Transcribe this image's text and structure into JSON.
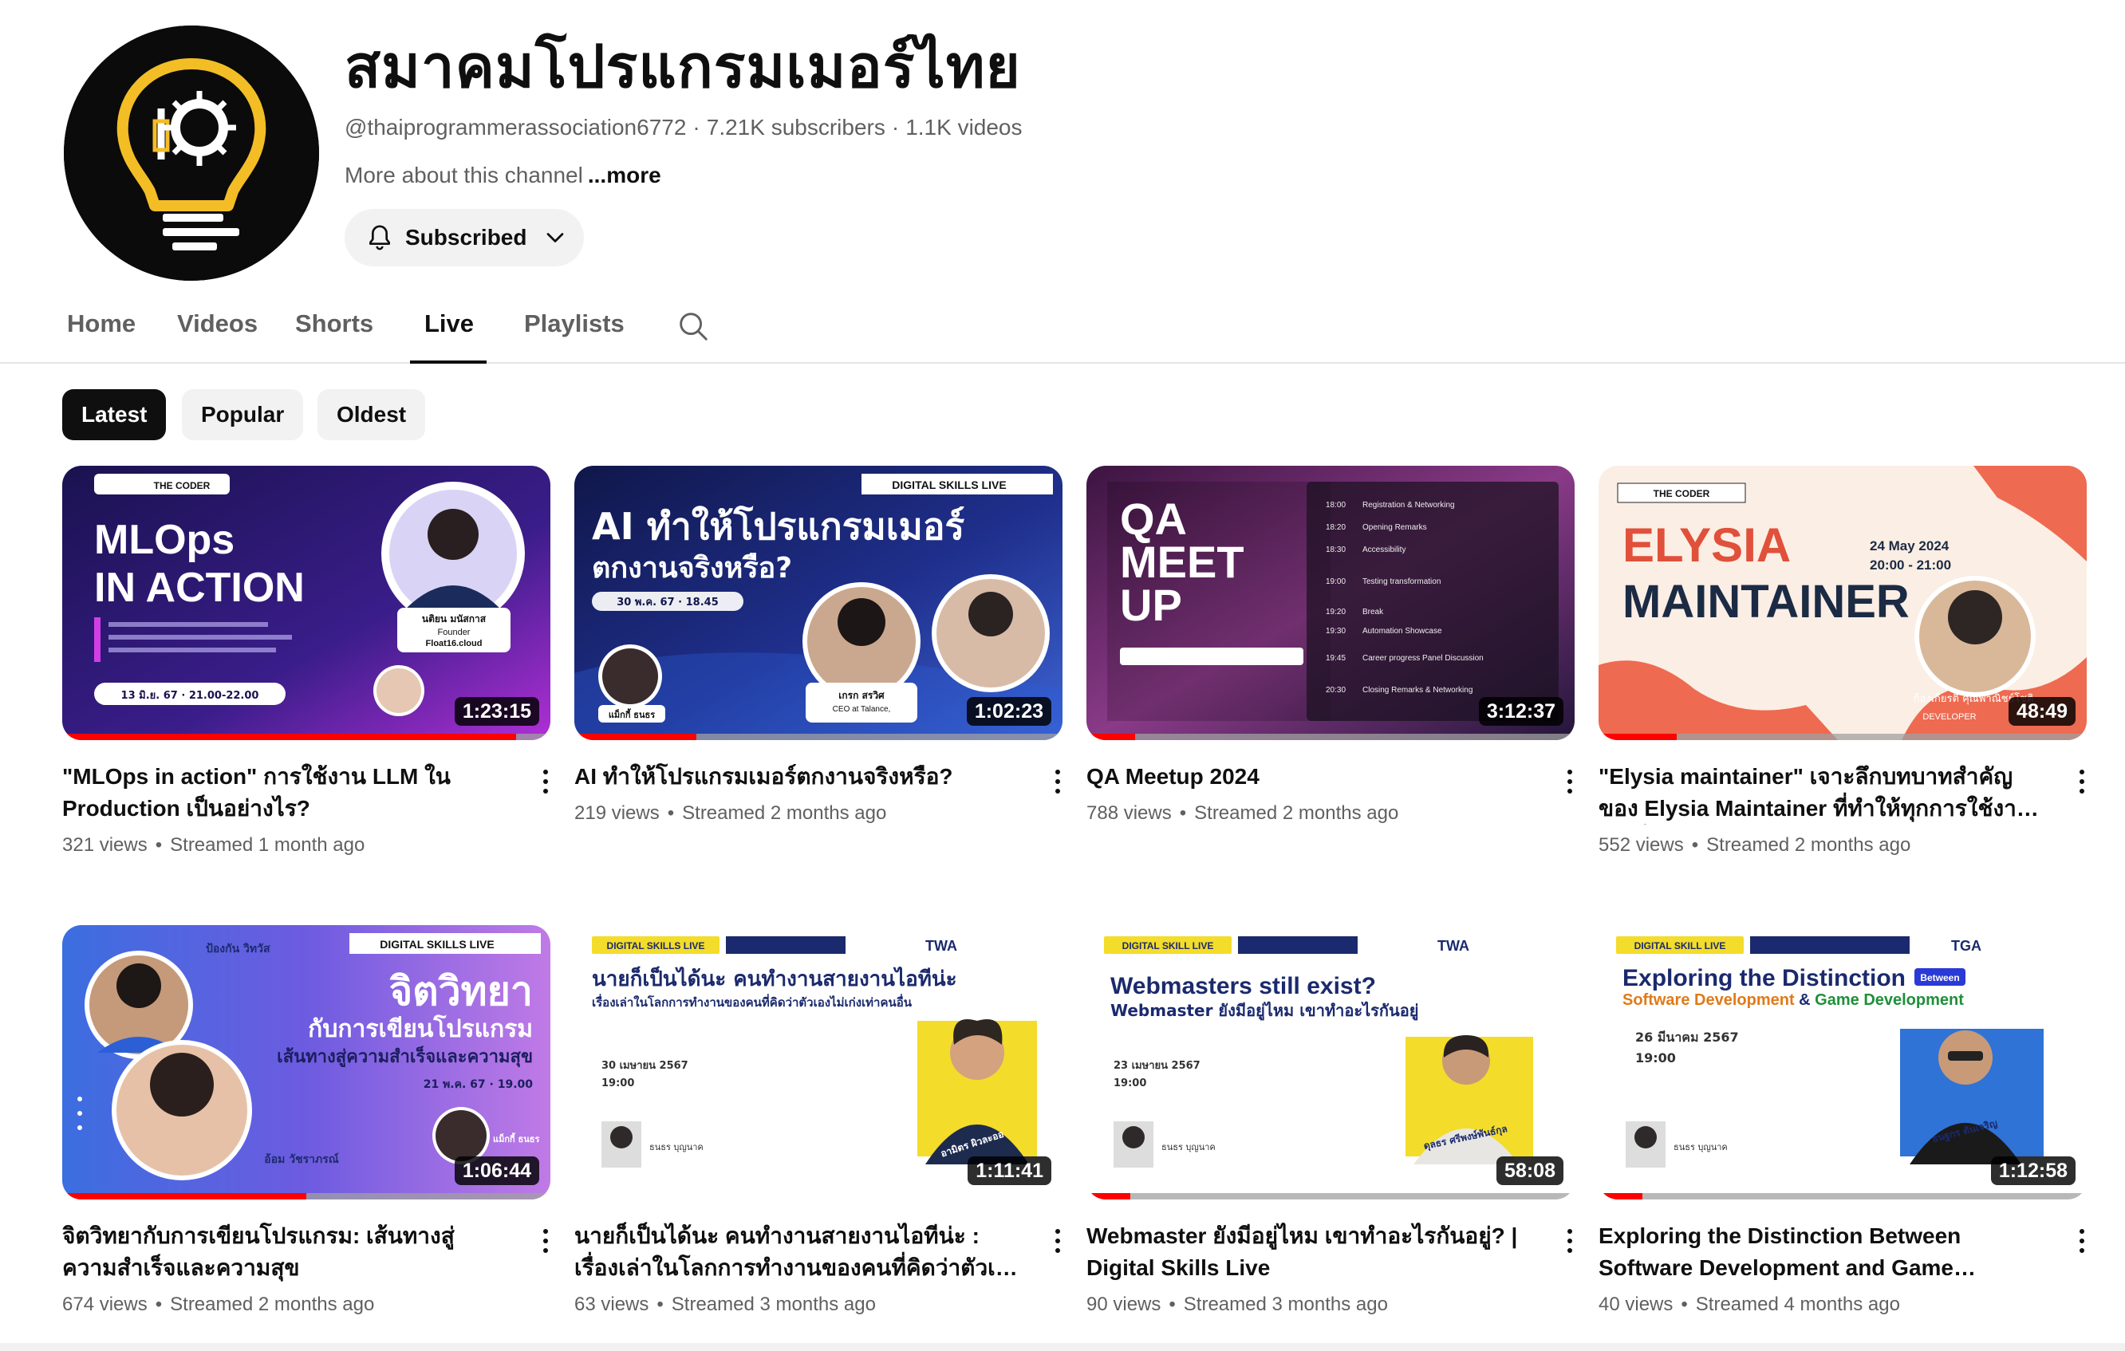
{
  "channel": {
    "name": "สมาคมโปรแกรมเมอร์ไทย",
    "handle": "@thaiprogrammerassociation6772",
    "subscribers": "7.21K subscribers",
    "videos": "1.1K videos",
    "about": "More about this channel",
    "about_more": "...more",
    "subscribe_label": "Subscribed"
  },
  "tabs": [
    {
      "label": "Home",
      "active": false
    },
    {
      "label": "Videos",
      "active": false
    },
    {
      "label": "Shorts",
      "active": false
    },
    {
      "label": "Live",
      "active": true
    },
    {
      "label": "Playlists",
      "active": false
    }
  ],
  "chips": [
    {
      "label": "Latest",
      "active": true
    },
    {
      "label": "Popular",
      "active": false
    },
    {
      "label": "Oldest",
      "active": false
    }
  ],
  "videos": [
    {
      "title": "\"MLOps in action\" การใช้งาน LLM ใน Production เป็นอย่างไร?",
      "views": "321 views",
      "streamed": "Streamed 1 month ago",
      "duration": "1:23:15",
      "progress": 0.93,
      "thumb": {
        "line1": "MLOps",
        "line2": "IN ACTION",
        "badge": "THE CODER",
        "date": "13 มิ.ย. 67 · 21.00-22.00",
        "speaker": "นติยน มนัสกาส",
        "speaker_role": "Founder",
        "speaker_org": "Float16.cloud"
      }
    },
    {
      "title": "AI ทำให้โปรแกรมเมอร์ตกงานจริงหรือ?",
      "views": "219 views",
      "streamed": "Streamed 2 months ago",
      "duration": "1:02:23",
      "progress": 0.25,
      "thumb": {
        "badge": "DIGITAL SKILLS LIVE",
        "line1": "AI ทำให้โปรแกรมเมอร์",
        "line2": "ตกงานจริงหรือ?",
        "date": "30 พ.ค. 67 · 18.45",
        "speaker": "เกรก สรวิศ",
        "speaker_role": "CEO at Talance,",
        "host": "แม็กกี้ ธนธร"
      }
    },
    {
      "title": "QA Meetup 2024",
      "views": "788 views",
      "streamed": "Streamed 2 months ago",
      "duration": "3:12:37",
      "progress": 0.1,
      "thumb": {
        "line1": "QA",
        "line2": "MEET",
        "line3": "UP",
        "agenda": [
          "Registration & Networking",
          "Opening Remarks",
          "Accessibility",
          "Testing transformation",
          "Break",
          "Automation Showcase",
          "Career progress Panel Discussion",
          "Closing Remarks & Networking"
        ],
        "times": [
          "18:00",
          "18:20",
          "18:30",
          "19:00",
          "19:20",
          "19:30",
          "19:45",
          "20:30"
        ]
      }
    },
    {
      "title": "\"Elysia maintainer\" เจาะลึกบทบาทสำคัญของ Elysia Maintainer ที่ทำให้ทุกการใช้งานราบรื่น...",
      "views": "552 views",
      "streamed": "Streamed 2 months ago",
      "duration": "48:49",
      "progress": 0.16,
      "thumb": {
        "badge": "THE CODER",
        "line1": "ELYSIA",
        "line2": "MAINTAINER",
        "date": "24 May 2024",
        "time": "20:00 - 21:00",
        "speaker": "ก้องเกียรติ คุณพาณิชย์โชติ",
        "speaker_role": "DEVELOPER"
      }
    },
    {
      "title": "จิตวิทยากับการเขียนโปรแกรม: เส้นทางสู่ความสำเร็จและความสุข",
      "views": "674 views",
      "streamed": "Streamed 2 months ago",
      "duration": "1:06:44",
      "progress": 0.5,
      "thumb": {
        "badge": "DIGITAL SKILLS LIVE",
        "line1": "จิตวิทยา",
        "line2": "กับการเขียนโปรแกรม",
        "line3": "เส้นทางสู่ความสำเร็จและความสุข",
        "date": "21 พ.ค. 67 · 19.00",
        "speaker": "ป้องกัน วิทวัส",
        "speaker2": "อ้อม วัชราภรณ์",
        "host": "แม็กกี้ ธนธร"
      }
    },
    {
      "title": "นายก็เป็นได้นะ คนทำงานสายงานไอทีน่ะ : เรื่องเล่าในโลกการทำงานของคนที่คิดว่าตัวเองไม่เก่ง...",
      "views": "63 views",
      "streamed": "Streamed 3 months ago",
      "duration": "1:11:41",
      "progress": 0.0,
      "thumb": {
        "badge": "DIGITAL SKILLS LIVE",
        "brand": "TWA",
        "line1": "นายก็เป็นได้นะ คนทำงานสายงานไอทีน่ะ",
        "line2": "เรื่องเล่าในโลกการทำงานของคนที่คิดว่าตัวเองไม่เก่งเท่าคนอื่น",
        "date": "30 เมษายน 2567",
        "time": "19:00",
        "speaker": "อามิตร ผิวละออ",
        "host": "ธนธร บุญนาค"
      }
    },
    {
      "title": "Webmaster ยังมีอยู่ไหม เขาทำอะไรกันอยู่? | Digital Skills Live",
      "views": "90 views",
      "streamed": "Streamed 3 months ago",
      "duration": "58:08",
      "progress": 0.09,
      "thumb": {
        "badge": "DIGITAL SKILL LIVE",
        "brand": "TWA",
        "line1": "Webmasters still exist?",
        "line2": "Webmaster ยังมีอยู่ไหม เขาทำอะไรกันอยู่",
        "date": "23 เมษายน 2567",
        "time": "19:00",
        "speaker": "ดุลธร ศรีพงษ์พันธ์กุล",
        "host": "ธนธร บุญนาค"
      }
    },
    {
      "title": "Exploring the Distinction Between Software Development and Game Development",
      "views": "40 views",
      "streamed": "Streamed 4 months ago",
      "duration": "1:12:58",
      "progress": 0.09,
      "thumb": {
        "badge": "DIGITAL SKILL LIVE",
        "brand": "TGA",
        "line1": "Exploring the Distinction",
        "tag": "Between",
        "line2a": "Software Development",
        "line2b": " & ",
        "line2c": "Game Development",
        "date": "26 มีนาคม 2567",
        "time": "19:00",
        "speaker": "ธนฐกร ตันเจริญ",
        "host": "ธนธร บุญนาค"
      }
    }
  ],
  "colors": {
    "accent": "#ff0000",
    "text": "#0f0f0f",
    "secondary": "#606060",
    "chip_bg": "#f2f2f2"
  },
  "icons": {
    "bell": "bell-icon",
    "chevron": "chevron-down-icon",
    "search": "search-icon",
    "menu": "more-vert-icon"
  }
}
